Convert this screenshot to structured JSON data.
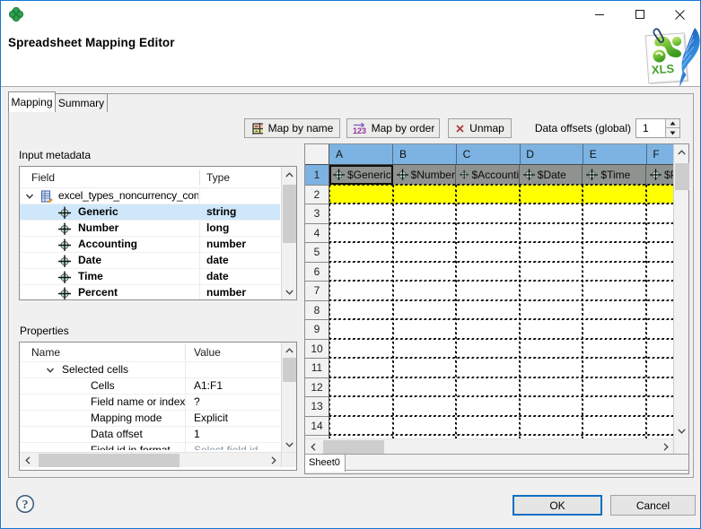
{
  "window": {
    "controls": {
      "minimize": "minimize",
      "maximize": "maximize",
      "close": "close"
    },
    "accent_color": "#1178d7"
  },
  "header": {
    "title": "Spreadsheet Mapping Editor",
    "file_icon": "xls-file-icon",
    "app_icon": "clover-icon"
  },
  "tabs": [
    {
      "label": "Mapping",
      "selected": true
    },
    {
      "label": "Summary",
      "selected": false
    }
  ],
  "toolbar": {
    "map_by_name": "Map by name",
    "map_by_order": "Map by order",
    "unmap": "Unmap",
    "data_offsets_label": "Data offsets (global)",
    "data_offsets_value": "1"
  },
  "input_metadata": {
    "label": "Input metadata",
    "columns": [
      "Field",
      "Type"
    ],
    "record": "excel_types_noncurrency_con",
    "fields": [
      {
        "name": "Generic",
        "type": "string",
        "selected": true
      },
      {
        "name": "Number",
        "type": "long",
        "selected": false
      },
      {
        "name": "Accounting",
        "type": "number",
        "selected": false
      },
      {
        "name": "Date",
        "type": "date",
        "selected": false
      },
      {
        "name": "Time",
        "type": "date",
        "selected": false
      },
      {
        "name": "Percent",
        "type": "number",
        "selected": false
      }
    ]
  },
  "properties": {
    "label": "Properties",
    "columns": [
      "Name",
      "Value"
    ],
    "group": "Selected cells",
    "rows": [
      {
        "name": "Cells",
        "value": "A1:F1"
      },
      {
        "name": "Field name or index",
        "value": "?"
      },
      {
        "name": "Mapping mode",
        "value": "Explicit"
      },
      {
        "name": "Data offset",
        "value": "1"
      },
      {
        "name": "Field id in format",
        "value": "Select field id"
      }
    ]
  },
  "spreadsheet": {
    "columns": [
      "A",
      "B",
      "C",
      "D",
      "E",
      "F"
    ],
    "row_numbers": [
      "1",
      "2",
      "3",
      "4",
      "5",
      "6",
      "7",
      "8",
      "9",
      "10",
      "11",
      "12",
      "13",
      "14"
    ],
    "mapped_cells": [
      "$Generic",
      "$Number",
      "$Accounting",
      "$Date",
      "$Time",
      "$Percent"
    ],
    "selected_cell": "A1",
    "sheet_tab": "Sheet0",
    "colors": {
      "header": "#7cb3e2",
      "mapped_row": "#8e938f",
      "data_row": "#ffff00",
      "selection": "#cfe7fa"
    }
  },
  "footer": {
    "help": "?",
    "ok": "OK",
    "cancel": "Cancel"
  }
}
